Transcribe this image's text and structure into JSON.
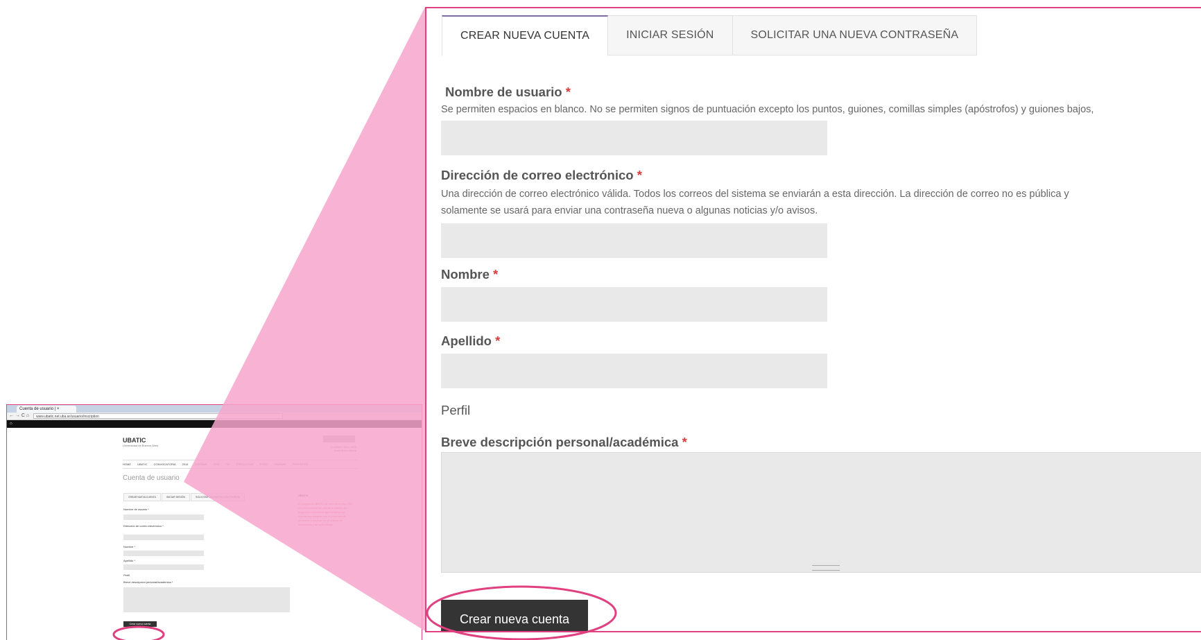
{
  "colors": {
    "highlight": "#e0407f",
    "wedge": "#f7a6cc",
    "field_bg": "#e9e9e9",
    "button_bg": "#343434",
    "required": "#d63d3d",
    "active_tab_border": "#7d6aa0"
  },
  "thumbnail": {
    "browser_tab": "Cuenta de usuario | ×",
    "url": "www.ubatic.net.uba.ar/usuario/inscription",
    "site_title": "UBATIC",
    "site_subtitle": "Universidad de Buenos Aires",
    "contact_line1": "Contacto: 4510-1620",
    "contact_line2": "ubatic@rec.uba.ar",
    "menu": "HOME   UBATIC   CONVOCATORIA 2014   DISEÑAR CON TIC   PREGUNTAS   FORO   CARGAR PROYECTO",
    "page_title": "Cuenta de usuario",
    "tabs": [
      "CREAR NUEVA CUENTA",
      "INICIAR SESIÓN",
      "SOLICITAR UNA NUEVA CONTRASEÑA"
    ],
    "labels": [
      "Nombre de usuario *",
      "Dirección de correo electrónico *",
      "Nombre *",
      "Apellido *",
      "Perfil",
      "Breve descripción personal/académica *"
    ],
    "sidebar_title": "UBATIC",
    "sidebar_text": "El programa UBATIC se creó en el año 2011. La convocatoria se orienta al diseño de proyectos educativos que integran las nuevas tecnologías con el propósito de promover y mejorar los procesos de enseñanza y de aprendizaje.",
    "submit": "Crear nueva cuenta"
  },
  "tabs": {
    "create": "CREAR NUEVA CUENTA",
    "login": "INICIAR SESIÓN",
    "reset": "SOLICITAR UNA NUEVA CONTRASEÑA"
  },
  "form": {
    "required_mark": "*",
    "username": {
      "label": "Nombre de usuario",
      "description": "Se permiten espacios en blanco. No se permiten signos de puntuación excepto los puntos, guiones, comillas simples (apóstrofos) y guiones bajos,",
      "value": ""
    },
    "email": {
      "label": "Dirección de correo electrónico",
      "description_line1": "Una dirección de correo electrónico válida. Todos los correos del sistema se enviarán a esta dirección. La dirección de correo no es pública y",
      "description_line2": "solamente se usará para enviar una contraseña nueva o algunas noticias y/o avisos.",
      "value": ""
    },
    "first_name": {
      "label": "Nombre",
      "value": ""
    },
    "last_name": {
      "label": "Apellido",
      "value": ""
    },
    "profile_section": "Perfil",
    "bio": {
      "label": "Breve descripción personal/académica",
      "value": ""
    },
    "submit_label": "Crear nueva cuenta"
  }
}
